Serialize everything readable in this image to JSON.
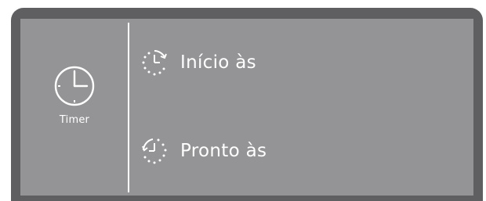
{
  "side_panel": {
    "icon": "clock-icon",
    "label": "Timer"
  },
  "menu": {
    "items": [
      {
        "label": "Início às",
        "icon": "start-time-icon"
      },
      {
        "label": "Pronto às",
        "icon": "ready-time-icon"
      }
    ]
  },
  "colors": {
    "bezel": "#5f5f61",
    "screen": "#949496",
    "foreground": "#ffffff"
  }
}
